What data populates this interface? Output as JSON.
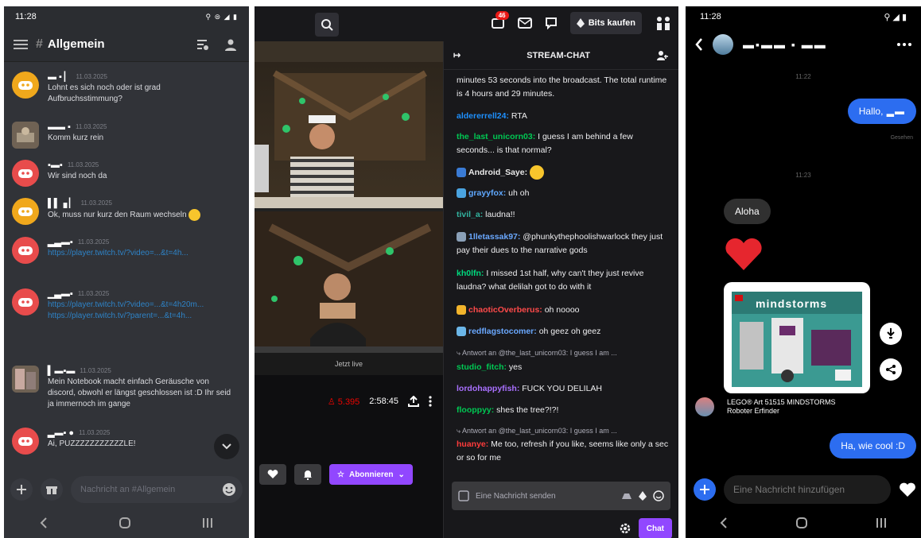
{
  "discord": {
    "status_time": "11:28",
    "status_icons": "⚲ ⊜ ◢ ▮",
    "channel_hash": "#",
    "channel": "Allgemein",
    "messages": [
      {
        "name": "",
        "time": "11.03.2025",
        "text": "Lohnt es sich noch oder ist grad Aufbruchsstimmung?"
      },
      {
        "name": "",
        "time": "11.03.2025",
        "text": "Komm kurz rein"
      },
      {
        "name": "",
        "time": "11.03.2025",
        "text": "Wir sind noch da"
      },
      {
        "name": "",
        "time": "11.03.2025",
        "text": "Ok, muss nur kurz den Raum wechseln"
      },
      {
        "name": "",
        "time": "11.03.2025",
        "text": "https://player.twitch.tv/?video=...&t=4h..."
      },
      {
        "name": "",
        "time": "11.03.2025",
        "text": "https://player.twitch.tv/?video=...&t=4h20m...",
        "text2": "https://player.twitch.tv/?parent=...&t=4h..."
      },
      {
        "name": "",
        "time": "11.03.2025",
        "text": "Mein Notebook macht einfach Geräusche von discord, obwohl er längst geschlossen ist :D Ihr seid ja immernoch im gange"
      },
      {
        "name": "",
        "time": "11.03.2025",
        "text": "Ai, PUZZZZZZZZZZZLE!"
      }
    ],
    "input_placeholder": "Nachricht an #Allgemein"
  },
  "twitch": {
    "notif_count": "46",
    "bits_label": "Bits kaufen",
    "chat_title": "STREAM-CHAT",
    "viewers": "5.395",
    "uptime": "2:58:45",
    "video_caption": "Jetzt live",
    "subscribe_label": "Abonnieren",
    "chat_placeholder": "Eine Nachricht senden",
    "chat_button": "Chat",
    "messages": [
      {
        "user": "",
        "color": "#efeff1",
        "text": "minutes 53 seconds into the broadcast. The total runtime is 4 hours and 29 minutes."
      },
      {
        "user": "aldererrell24:",
        "color": "#1e90ff",
        "text": " RTA"
      },
      {
        "user": "the_last_unicorn03:",
        "color": "#00c853",
        "text": " I guess I am behind a few seconds... is that normal?"
      },
      {
        "user": "Android_Saye:",
        "color": "#e8e8e8",
        "text": ""
      },
      {
        "user": "grayyfox:",
        "color": "#5fa8ff",
        "text": " uh oh"
      },
      {
        "user": "tivil_a:",
        "color": "#32b4a0",
        "text": " laudna!!"
      },
      {
        "user": "1lletassak97:",
        "color": "#6aa8ff",
        "text": " @phunkythephoolishwarlock they just pay their dues to the narrative gods"
      },
      {
        "user": "kh0lfn:",
        "color": "#00d97e",
        "text": " I missed 1st half, why can't they just revive laudna? what delilah got to do with it"
      },
      {
        "user": "chaoticOverberus:",
        "color": "#ff4a4a",
        "text": " oh noooo"
      },
      {
        "user": "redflagstocomer:",
        "color": "#6aa8ff",
        "text": " oh geez oh geez"
      },
      {
        "user": "",
        "color": "#adadb8",
        "text": "Antwort an @the_last_unicorn03: I guess I am ..."
      },
      {
        "user": "studio_fitch:",
        "color": "#00c853",
        "text": " yes"
      },
      {
        "user": "lordohappyfish:",
        "color": "#a970ff",
        "text": " FUCK YOU DELILAH"
      },
      {
        "user": "flooppyy:",
        "color": "#00c853",
        "text": " shes the tree?!?!"
      },
      {
        "user": "",
        "color": "#adadb8",
        "text": "Antwort an @the_last_unicorn03: I guess I am ..."
      },
      {
        "user": "huanye:",
        "color": "#ff3b3b",
        "text": " Me too, refresh if you like, seems like only a sec or so for me"
      }
    ]
  },
  "messenger": {
    "status_time": "11:28",
    "status_icons": "⚲ ◢ ▮",
    "contact_name": "",
    "ts1": "11:22",
    "sent1": "Hallo,",
    "seen": "Gesehen",
    "ts2": "11:23",
    "recv1": "Aloha",
    "product_brand": "mindstorms",
    "product_caption_1": "LEGO® Art 51515 MINDSTORMS",
    "product_caption_2": "Roboter Erfinder",
    "sent2": "Ha, wie cool :D",
    "input_placeholder": "Eine Nachricht hinzufügen"
  },
  "colors": {
    "discord_bg": "#313338",
    "twitch_purple": "#9147ff",
    "messenger_blue": "#2c6df0"
  }
}
